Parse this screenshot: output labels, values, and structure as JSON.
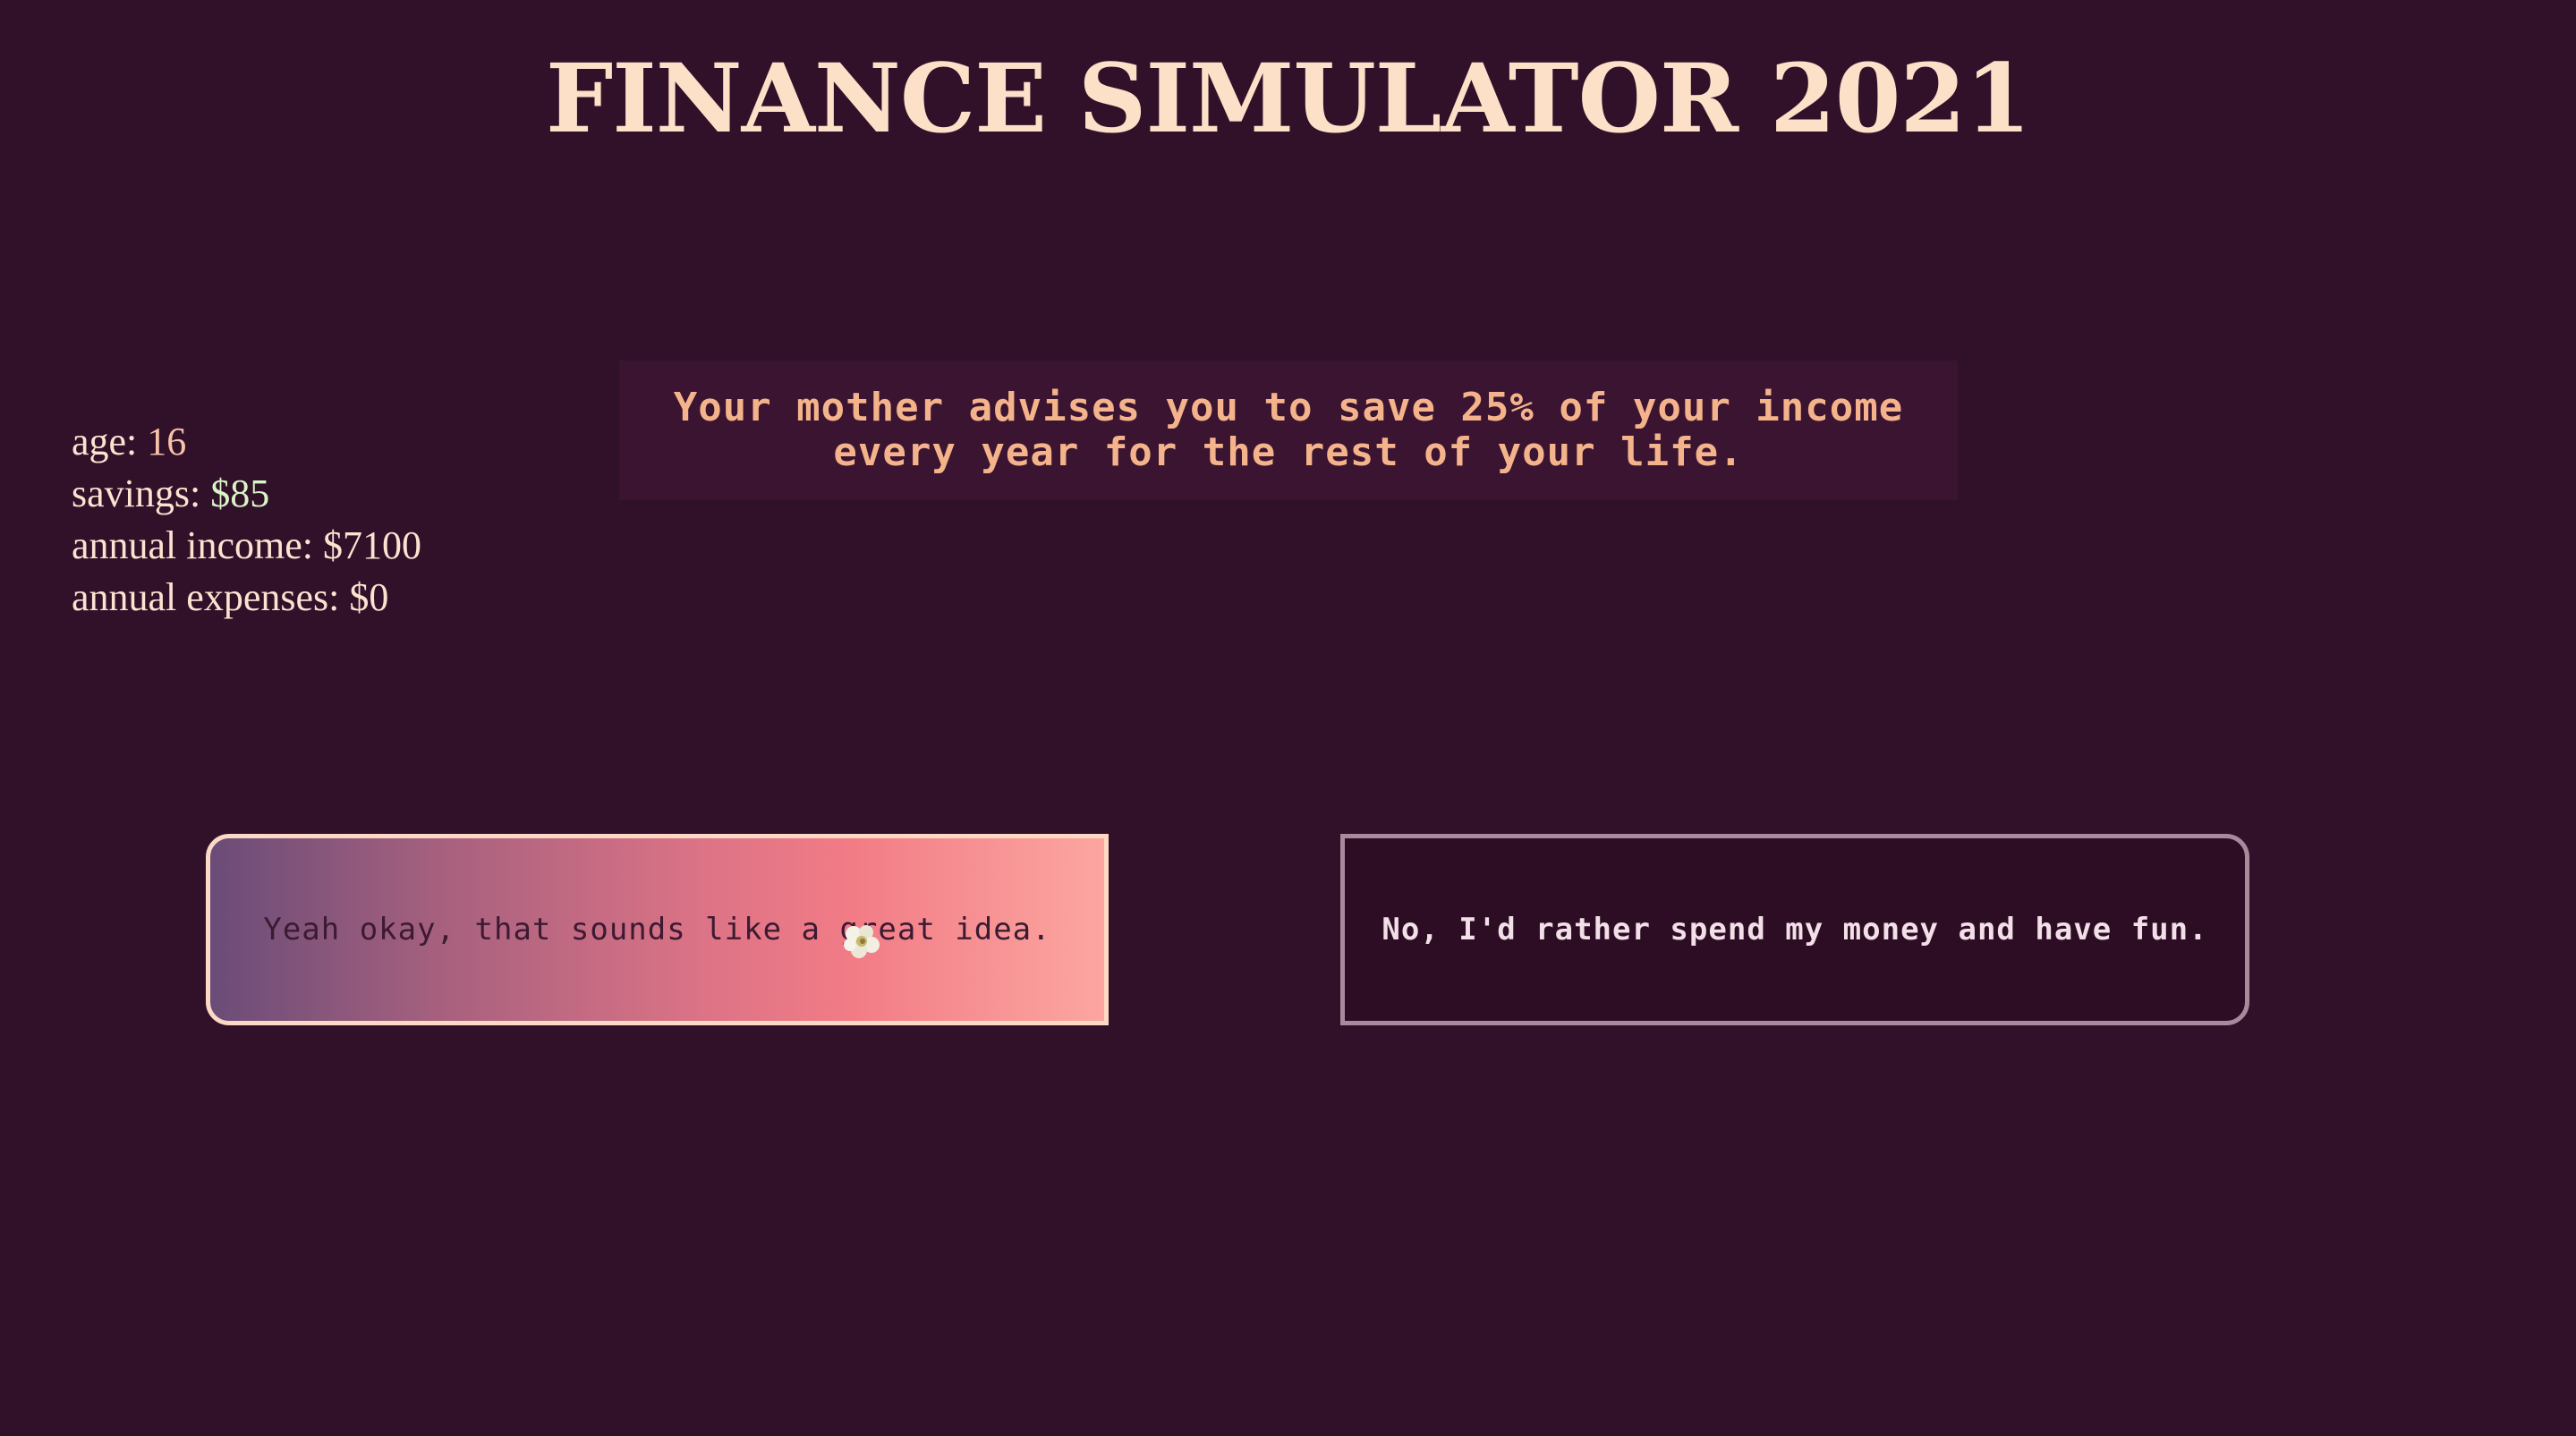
{
  "title": "FINANCE SIMULATOR 2021",
  "stats": {
    "age_label": "age: ",
    "age_value": "16",
    "savings_label": "savings: ",
    "savings_value": "$85",
    "income_label": "annual income: ",
    "income_value": "$7100",
    "expenses_label": "annual expenses: ",
    "expenses_value": "$0"
  },
  "prompt": {
    "line1": "Your mother advises you to save 25% of your income",
    "line2": "every year for the rest of your life."
  },
  "choices": {
    "accept_label": "Yeah okay, that sounds like a great idea.",
    "decline_label": "No, I'd rather spend my money and have fun."
  },
  "icons": {
    "cursor": "flower-cursor-icon"
  },
  "colors": {
    "background": "#31112a",
    "title": "#fde0c8",
    "prompt_text": "#f4b38a",
    "savings_value": "#d9f5c6"
  }
}
